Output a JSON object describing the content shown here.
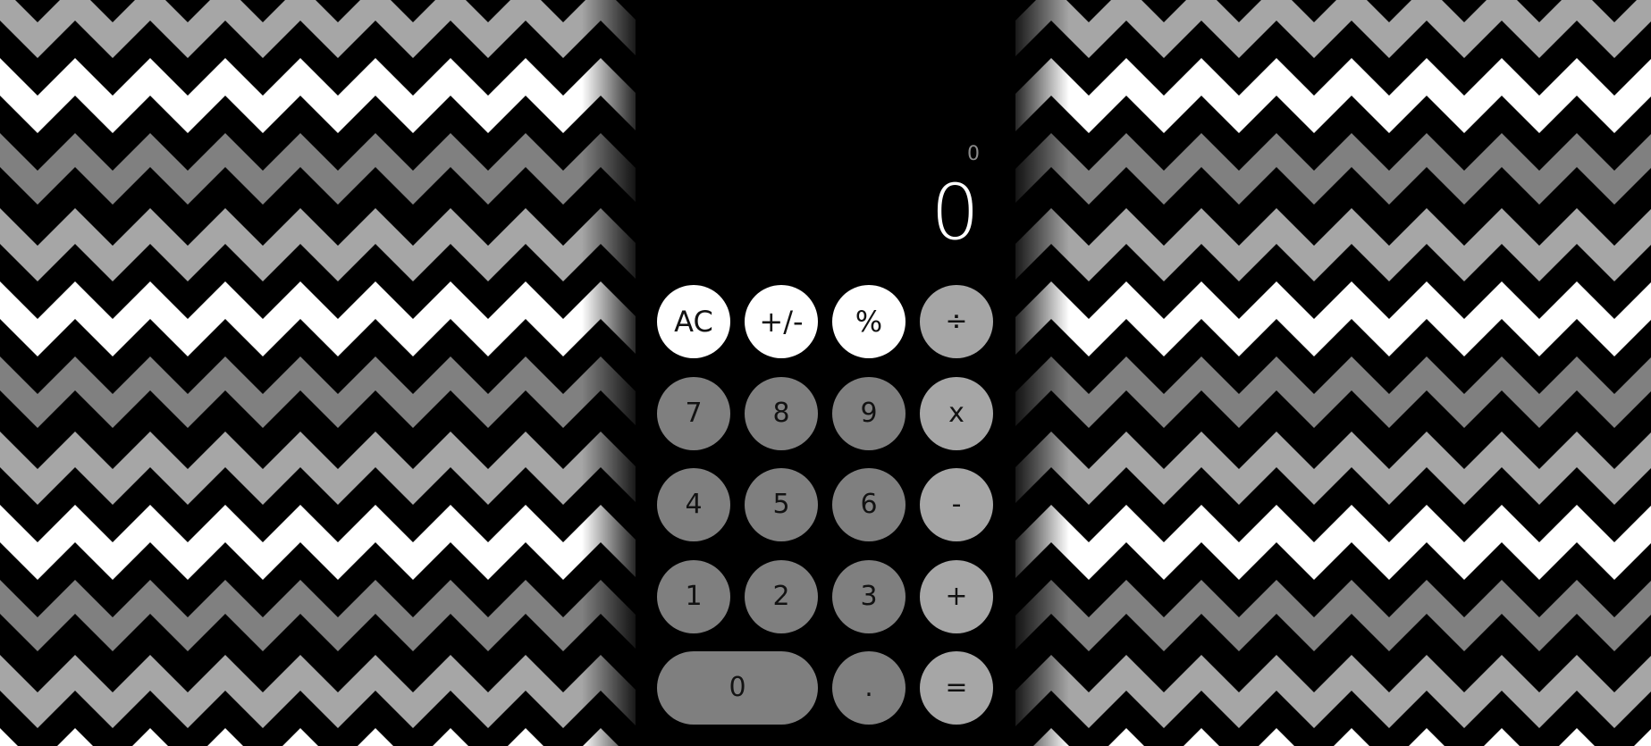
{
  "display": {
    "previous": "0",
    "current": "0"
  },
  "keys": {
    "ac": "AC",
    "sign": "+/-",
    "percent": "%",
    "divide": "÷",
    "seven": "7",
    "eight": "8",
    "nine": "9",
    "multiply": "x",
    "four": "4",
    "five": "5",
    "six": "6",
    "subtract": "-",
    "one": "1",
    "two": "2",
    "three": "3",
    "add": "+",
    "zero": "0",
    "decimal": ".",
    "equals": "="
  },
  "colors": {
    "calc_background": "#000000",
    "function_key": "#ffffff",
    "operator_key": "#a6a6a6",
    "digit_key": "#7f7f7f",
    "pattern_white": "#ffffff",
    "pattern_light_gray": "#a6a6a6",
    "pattern_dark_gray": "#808080",
    "pattern_black": "#000000"
  }
}
